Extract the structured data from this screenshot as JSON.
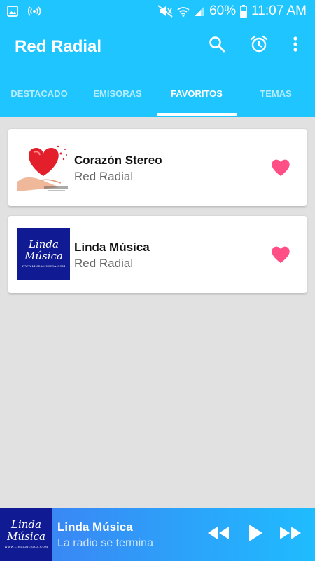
{
  "status_bar": {
    "battery": "60%",
    "time": "11:07 AM"
  },
  "app": {
    "title": "Red Radial"
  },
  "tabs": [
    {
      "label": "DESTACADO",
      "active": false
    },
    {
      "label": "EMISORAS",
      "active": false
    },
    {
      "label": "FAVORITOS",
      "active": true
    },
    {
      "label": "TEMAS",
      "active": false
    }
  ],
  "favorites": [
    {
      "name": "Corazón Stereo",
      "network": "Red Radial",
      "thumb": "corazon-stereo-logo"
    },
    {
      "name": "Linda Música",
      "network": "Red Radial",
      "thumb": "linda-musica-logo"
    }
  ],
  "logo_text": {
    "linda_line1": "Linda",
    "linda_line2": "Música",
    "linda_web": "WWW.LINDAMUSICA.COM"
  },
  "player": {
    "title": "Linda Música",
    "subtitle": "La radio se termina"
  },
  "colors": {
    "appbar": "#1ec5ff",
    "heart": "#ff4f86",
    "logo_bg": "#0f1a93"
  }
}
